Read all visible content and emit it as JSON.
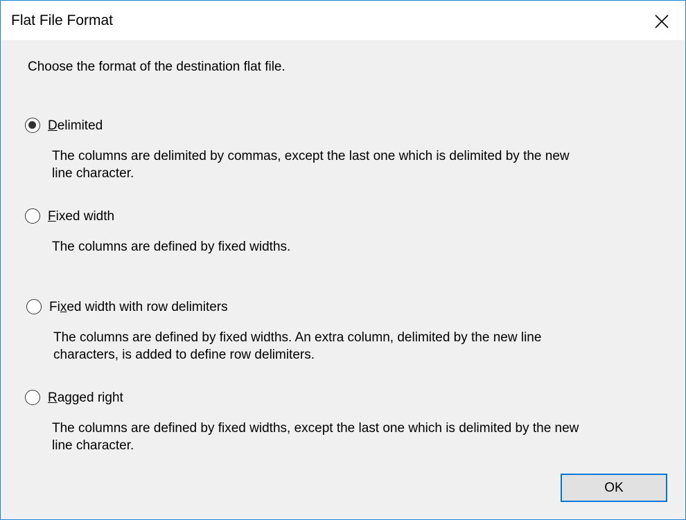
{
  "dialog": {
    "title": "Flat File Format",
    "instruction": "Choose the format of the destination flat file.",
    "ok_label": "OK",
    "accent_color": "#0078d7"
  },
  "options": [
    {
      "pre": "",
      "key": "D",
      "post": "elimited",
      "selected": true,
      "desc1": "The columns are delimited by commas, except the last one which is delimited by the new",
      "desc2": "line character."
    },
    {
      "pre": "",
      "key": "F",
      "post": "ixed width",
      "selected": false,
      "desc1": "The columns are defined by fixed widths.",
      "desc2": ""
    },
    {
      "pre": "Fi",
      "key": "x",
      "post": "ed width with row delimiters",
      "selected": false,
      "desc1": "The columns are defined by fixed widths. An extra column, delimited by the new line",
      "desc2": "characters, is added to define row delimiters."
    },
    {
      "pre": "",
      "key": "R",
      "post": "agged right",
      "selected": false,
      "desc1": "The columns are defined by fixed widths, except the last one which is delimited by the new",
      "desc2": "line character."
    }
  ]
}
